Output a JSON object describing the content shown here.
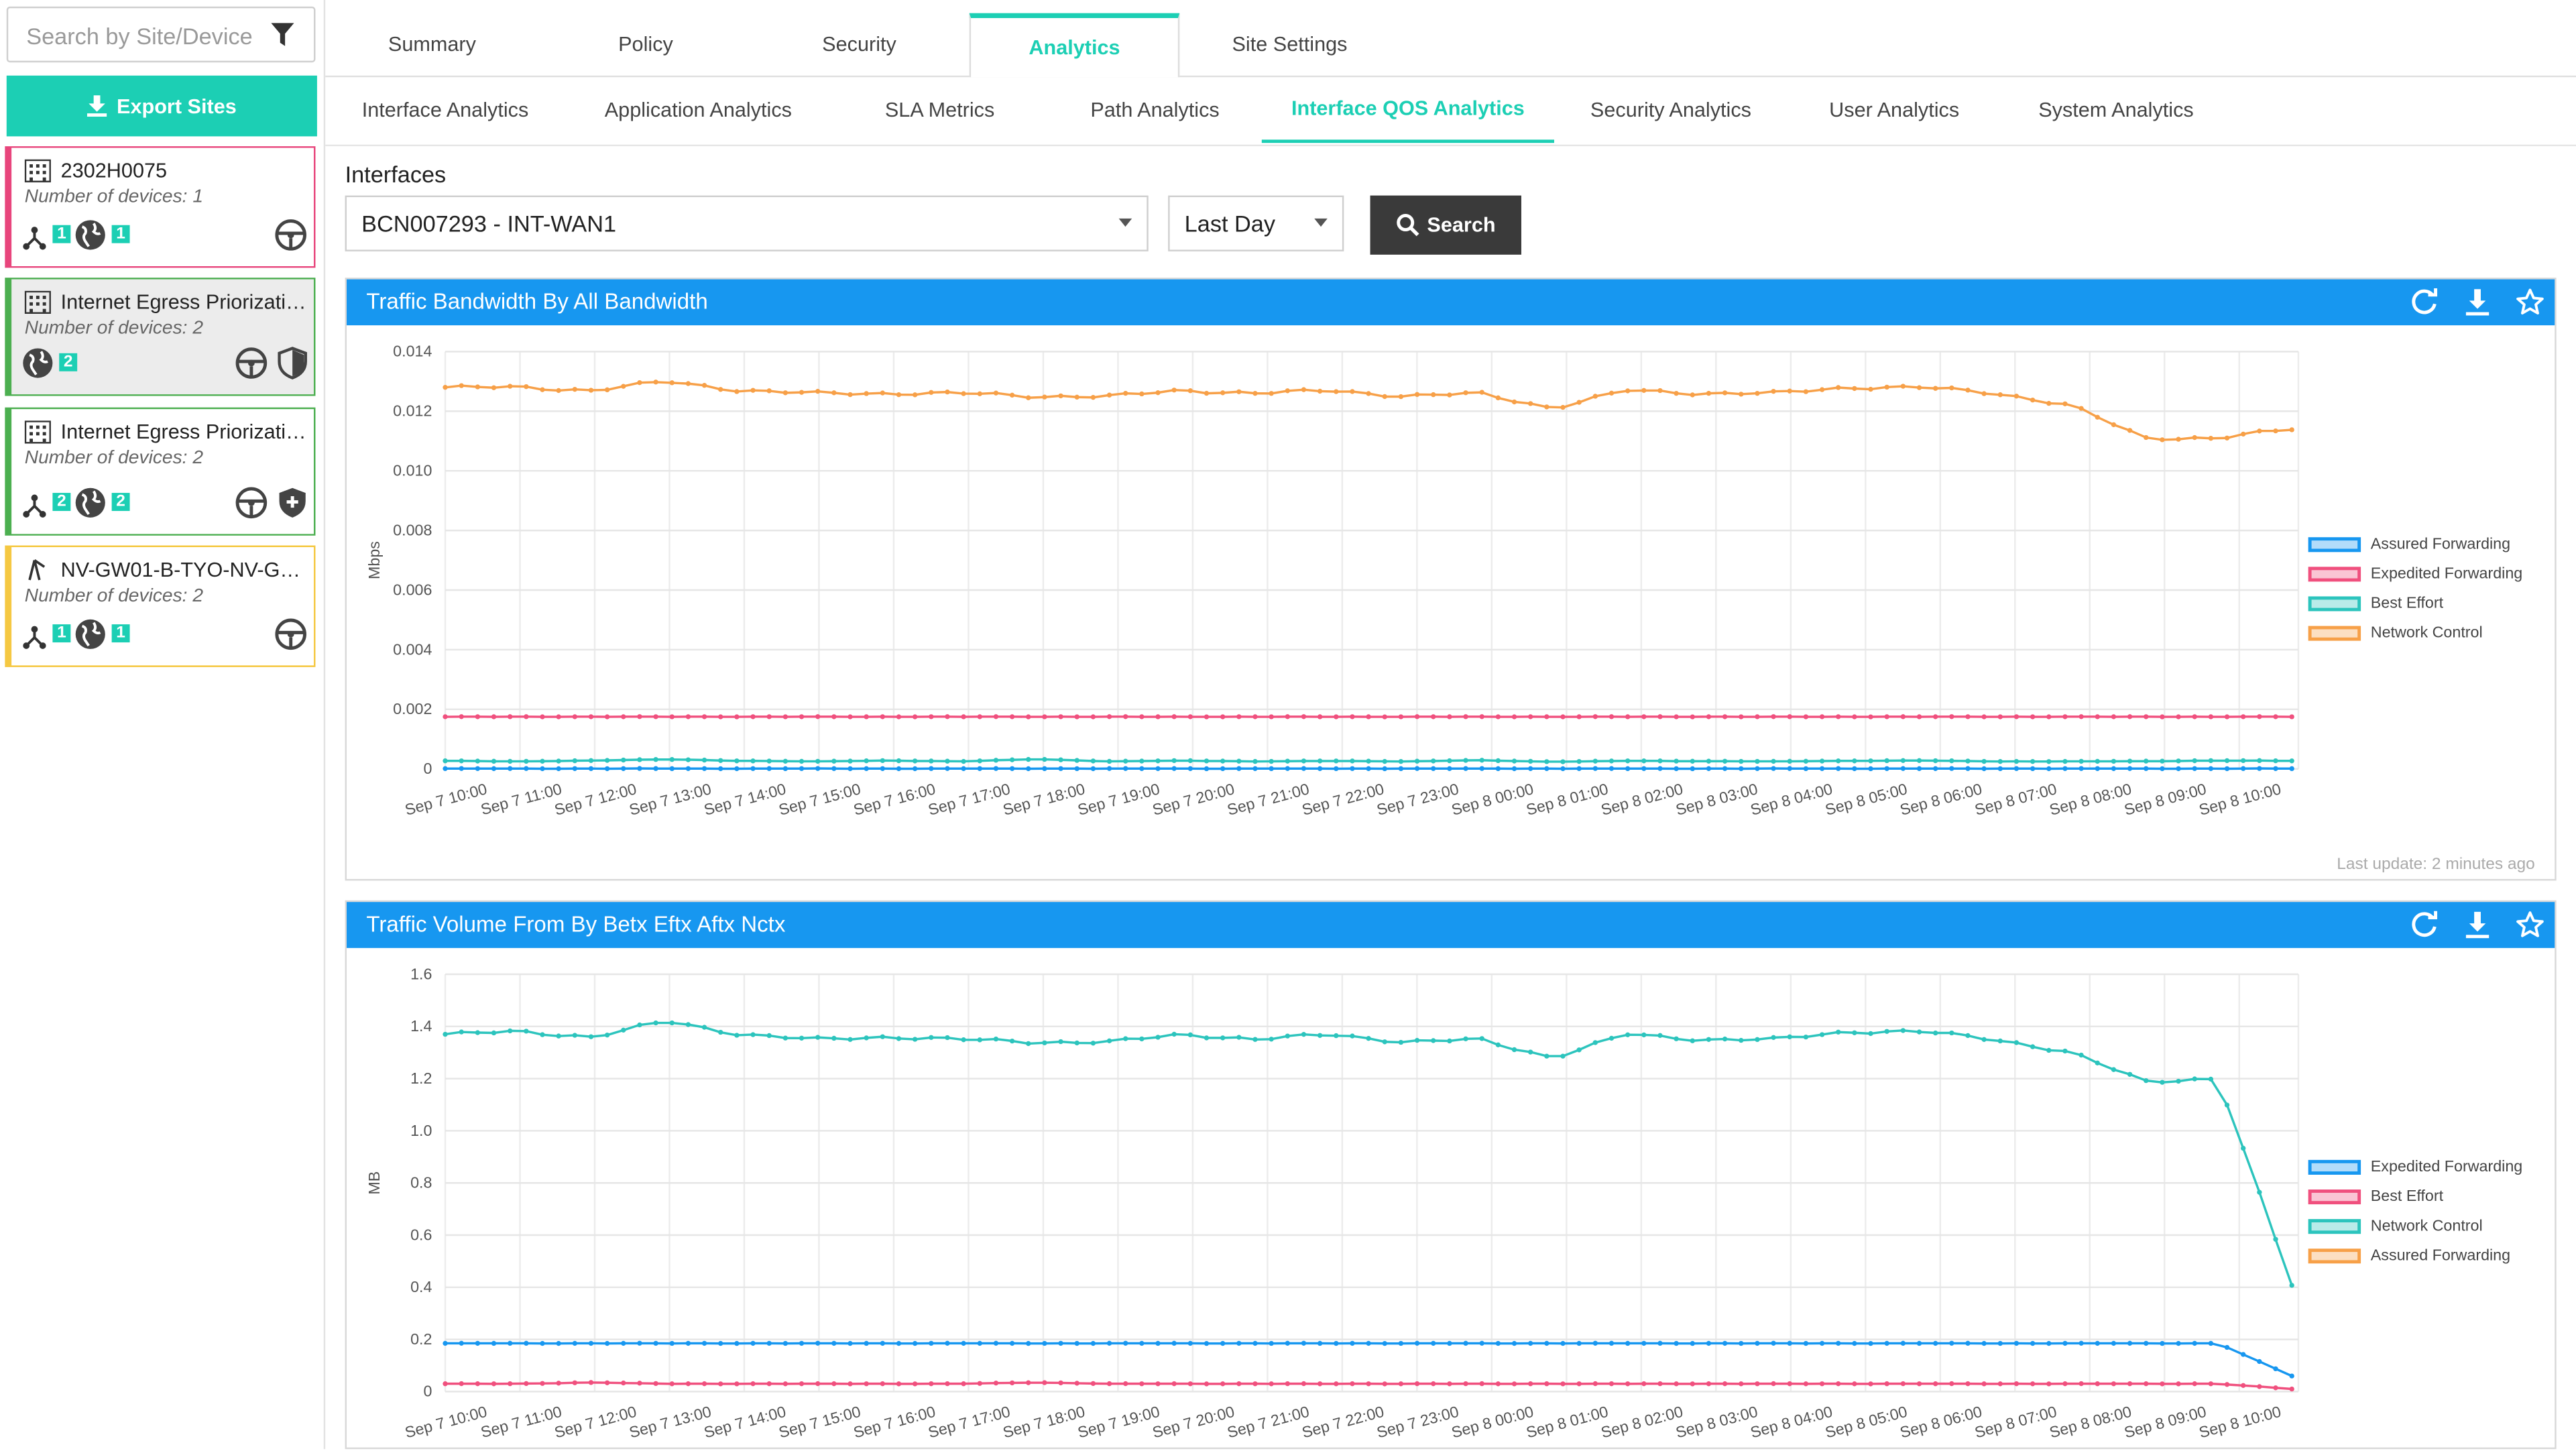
{
  "sidebar": {
    "search_placeholder": "Search by Site/Device",
    "export_label": "Export Sites",
    "sites": [
      {
        "name": "2302H0075",
        "devices": "Number of devices: 1",
        "border": "#e8457c",
        "badges": [
          "1",
          "1"
        ],
        "icons": [
          "topology-icon",
          "globe-icon"
        ],
        "right": [
          "steering-icon"
        ]
      },
      {
        "name": "Internet Egress Priorization-...",
        "devices": "Number of devices: 2",
        "border": "#4caf50",
        "badges": [
          "2"
        ],
        "icons": [
          "globe-icon"
        ],
        "right": [
          "steering-icon",
          "shield-icon"
        ],
        "highlight": "#ececec"
      },
      {
        "name": "Internet Egress Priorization-...",
        "devices": "Number of devices: 2",
        "border": "#4caf50",
        "badges": [
          "2",
          "2"
        ],
        "icons": [
          "topology-icon",
          "globe-icon"
        ],
        "right": [
          "steering-icon",
          "shield-plus-icon"
        ]
      },
      {
        "name": "NV-GW01-B-TYO-NV-GW...",
        "devices": "Number of devices: 2",
        "border": "#f5c842",
        "badges": [
          "1",
          "1"
        ],
        "icons": [
          "topology-icon",
          "globe-icon"
        ],
        "right": [
          "steering-icon"
        ]
      }
    ]
  },
  "tabs": [
    "Summary",
    "Policy",
    "Security",
    "Analytics",
    "Site Settings"
  ],
  "active_tab": "Analytics",
  "subtabs": [
    "Interface Analytics",
    "Application Analytics",
    "SLA Metrics",
    "Path Analytics",
    "Interface QOS Analytics",
    "Security Analytics",
    "User Analytics",
    "System Analytics"
  ],
  "active_subtab": "Interface QOS Analytics",
  "filters": {
    "label": "Interfaces",
    "interface": "BCN007293 - INT-WAN1",
    "range": "Last Day",
    "search_label": "Search"
  },
  "chart_data": [
    {
      "type": "line",
      "title": "Traffic Bandwidth By All Bandwidth",
      "ylabel": "Mbps",
      "ylim": [
        0,
        0.014
      ],
      "yticks": [
        "0",
        "0.002",
        "0.004",
        "0.006",
        "0.008",
        "0.010",
        "0.012",
        "0.014"
      ],
      "x": [
        "Sep 7 10:00",
        "Sep 7 11:00",
        "Sep 7 12:00",
        "Sep 7 13:00",
        "Sep 7 14:00",
        "Sep 7 15:00",
        "Sep 7 16:00",
        "Sep 7 17:00",
        "Sep 7 18:00",
        "Sep 7 19:00",
        "Sep 7 20:00",
        "Sep 7 21:00",
        "Sep 7 22:00",
        "Sep 7 23:00",
        "Sep 8 00:00",
        "Sep 8 01:00",
        "Sep 8 02:00",
        "Sep 8 03:00",
        "Sep 8 04:00",
        "Sep 8 05:00",
        "Sep 8 06:00",
        "Sep 8 07:00",
        "Sep 8 08:00",
        "Sep 8 09:00",
        "Sep 8 10:00"
      ],
      "legend_position": "right",
      "footer": "Last update: 2 minutes ago",
      "series": [
        {
          "name": "Assured Forwarding",
          "color": "#1797f0",
          "values": [
            1e-05,
            1e-05,
            1e-05,
            1e-05,
            1e-05,
            1e-05,
            1e-05,
            1e-05,
            1e-05,
            1e-05,
            1e-05,
            1e-05,
            1e-05,
            1e-05,
            1e-05,
            1e-05,
            1e-05,
            1e-05,
            1e-05,
            1e-05,
            1e-05,
            1e-05,
            1e-05,
            1e-05,
            1e-05,
            1e-05
          ]
        },
        {
          "name": "Expedited Forwarding",
          "color": "#f0507e",
          "values": [
            0.00175,
            0.00175,
            0.00175,
            0.00175,
            0.00175,
            0.00175,
            0.00175,
            0.00175,
            0.00175,
            0.00175,
            0.00175,
            0.00175,
            0.00175,
            0.00175,
            0.00175,
            0.00175,
            0.00175,
            0.00175,
            0.00175,
            0.00175,
            0.00175,
            0.00175,
            0.00175,
            0.00175,
            0.00175,
            0.00175
          ]
        },
        {
          "name": "Best Effort",
          "color": "#2cc4bd",
          "values": [
            0.00027,
            0.00025,
            0.00028,
            0.00032,
            0.00027,
            0.00025,
            0.00028,
            0.00025,
            0.00033,
            0.00025,
            0.00028,
            0.00025,
            0.00027,
            0.00025,
            0.00029,
            0.00024,
            0.00027,
            0.00026,
            0.00025,
            0.00027,
            0.00028,
            0.00025,
            0.00025,
            0.00026,
            0.00028,
            0.00027
          ]
        },
        {
          "name": "Network Control",
          "color": "#f7a048",
          "values": [
            0.0128,
            0.0128,
            0.0127,
            0.013,
            0.0127,
            0.0126,
            0.0126,
            0.0126,
            0.0125,
            0.0125,
            0.0127,
            0.0126,
            0.0127,
            0.0125,
            0.0126,
            0.0121,
            0.0127,
            0.0126,
            0.0126,
            0.0128,
            0.0128,
            0.0126,
            0.0122,
            0.0111,
            0.0111,
            0.0114
          ]
        }
      ]
    },
    {
      "type": "line",
      "title": "Traffic Volume From By Betx Eftx Aftx Nctx",
      "ylabel": "MB",
      "ylim": [
        0,
        1.6
      ],
      "yticks": [
        "0",
        "0.2",
        "0.4",
        "0.6",
        "0.8",
        "1.0",
        "1.2",
        "1.4",
        "1.6"
      ],
      "x": [
        "Sep 7 10:00",
        "Sep 7 11:00",
        "Sep 7 12:00",
        "Sep 7 13:00",
        "Sep 7 14:00",
        "Sep 7 15:00",
        "Sep 7 16:00",
        "Sep 7 17:00",
        "Sep 7 18:00",
        "Sep 7 19:00",
        "Sep 7 20:00",
        "Sep 7 21:00",
        "Sep 7 22:00",
        "Sep 7 23:00",
        "Sep 8 00:00",
        "Sep 8 01:00",
        "Sep 8 02:00",
        "Sep 8 03:00",
        "Sep 8 04:00",
        "Sep 8 05:00",
        "Sep 8 06:00",
        "Sep 8 07:00",
        "Sep 8 08:00",
        "Sep 8 09:00",
        "Sep 8 10:00"
      ],
      "legend_position": "right",
      "series": [
        {
          "name": "Expedited Forwarding",
          "color": "#1797f0",
          "values": [
            0.185,
            0.185,
            0.185,
            0.185,
            0.185,
            0.185,
            0.185,
            0.185,
            0.185,
            0.185,
            0.185,
            0.185,
            0.185,
            0.185,
            0.185,
            0.185,
            0.185,
            0.185,
            0.185,
            0.185,
            0.185,
            0.185,
            0.185,
            0.185,
            0.185,
            0.06
          ]
        },
        {
          "name": "Best Effort",
          "color": "#f0507e",
          "values": [
            0.03,
            0.03,
            0.035,
            0.03,
            0.03,
            0.03,
            0.03,
            0.03,
            0.035,
            0.03,
            0.03,
            0.03,
            0.03,
            0.03,
            0.03,
            0.03,
            0.03,
            0.03,
            0.03,
            0.03,
            0.03,
            0.03,
            0.03,
            0.03,
            0.03,
            0.01
          ]
        },
        {
          "name": "Network Control",
          "color": "#2cc4bd",
          "values": [
            1.37,
            1.38,
            1.36,
            1.42,
            1.37,
            1.35,
            1.36,
            1.35,
            1.34,
            1.34,
            1.37,
            1.35,
            1.37,
            1.34,
            1.35,
            1.28,
            1.37,
            1.35,
            1.35,
            1.38,
            1.38,
            1.35,
            1.3,
            1.19,
            1.2,
            0.41
          ]
        },
        {
          "name": "Assured Forwarding",
          "color": "#f7a048",
          "values": []
        }
      ]
    }
  ]
}
